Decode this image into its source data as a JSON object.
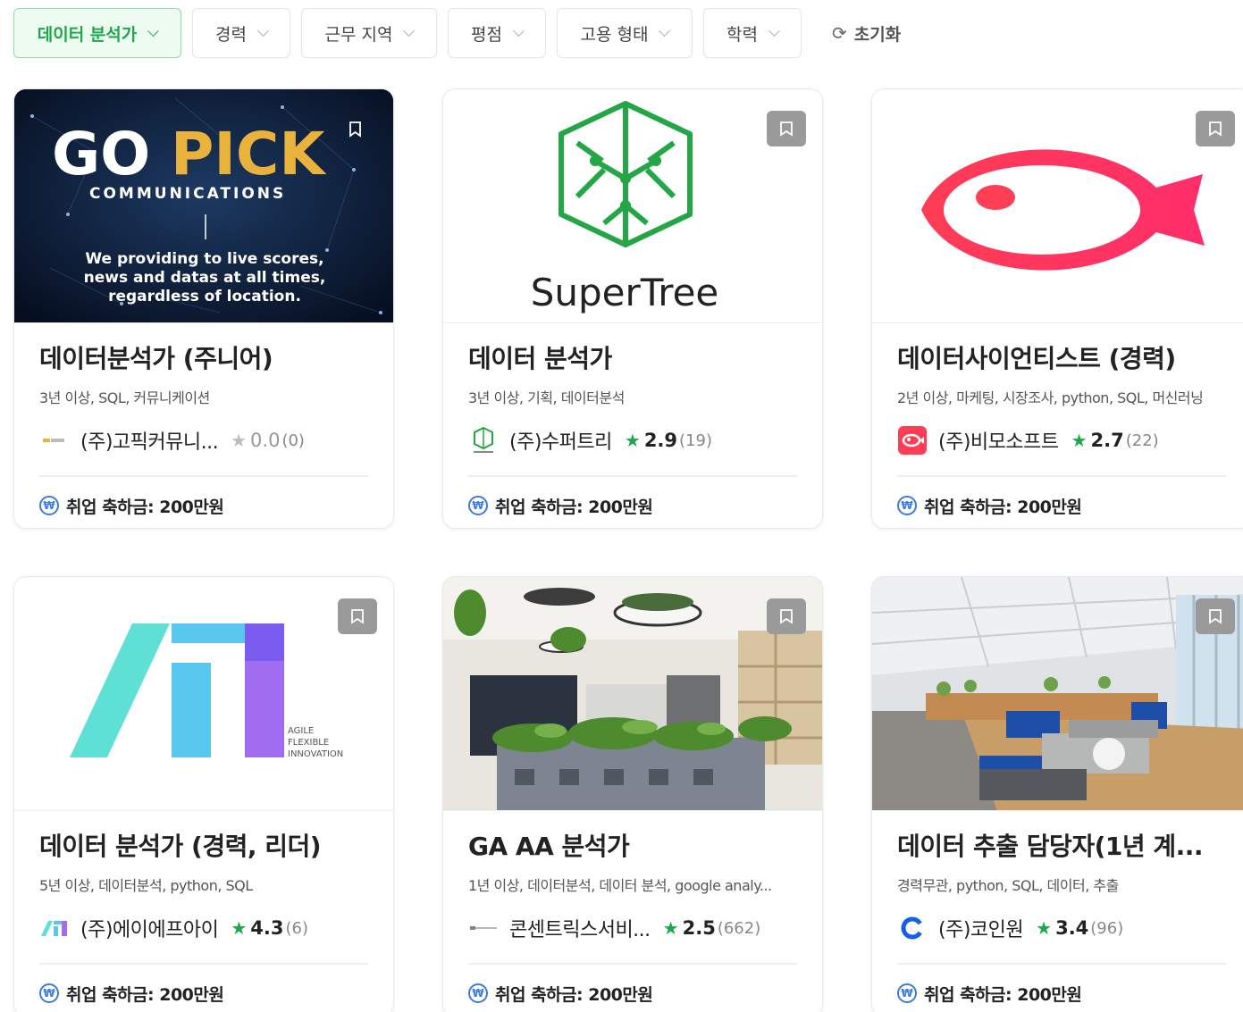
{
  "filters": [
    {
      "label": "데이터 분석가",
      "active": true
    },
    {
      "label": "경력"
    },
    {
      "label": "근무 지역"
    },
    {
      "label": "평점"
    },
    {
      "label": "고용 형태"
    },
    {
      "label": "학력"
    }
  ],
  "reset_label": "초기화",
  "cards": [
    {
      "title": "데이터분석가 (주니어)",
      "tags": "3년 이상, SQL, 커뮤니케이션",
      "company": "(주)고픽커뮤니...",
      "rating": "0.0",
      "count": "(0)",
      "bonus": "취업 축하금: 200만원",
      "logo_text": {
        "go": "GO",
        "pick": "PICK",
        "sub": "COMMUNICATIONS",
        "line1": "We providing to live scores,",
        "line2": "news and datas at all times,",
        "line3": "regardless of location."
      }
    },
    {
      "title": "데이터 분석가",
      "tags": "3년 이상, 기획, 데이터분석",
      "company": "(주)수퍼트리",
      "rating": "2.9",
      "count": "(19)",
      "bonus": "취업 축하금: 200만원",
      "logo_text": {
        "name": "SuperTree"
      }
    },
    {
      "title": "데이터사이언티스트 (경력)",
      "tags": "2년 이상, 마케팅, 시장조사, python, SQL, 머신러닝",
      "company": "(주)비모소프트",
      "rating": "2.7",
      "count": "(22)",
      "bonus": "취업 축하금: 200만원"
    },
    {
      "title": "데이터 분석가 (경력, 리더)",
      "tags": "5년 이상, 데이터분석, python, SQL",
      "company": "(주)에이에프아이",
      "rating": "4.3",
      "count": "(6)",
      "bonus": "취업 축하금: 200만원",
      "logo_text": {
        "l1": "AGILE",
        "l2": "FLEXIBLE",
        "l3": "INNOVATION"
      }
    },
    {
      "title": "GA AA 분석가",
      "tags": "1년 이상, 데이터분석, 데이터 분석, google analy...",
      "company": "콘센트릭스서비...",
      "rating": "2.5",
      "count": "(662)",
      "bonus": "취업 축하금: 200만원"
    },
    {
      "title": "데이터 추출 담당자(1년 계...",
      "tags": "경력무관, python, SQL, 데이터, 추출",
      "company": "(주)코인원",
      "rating": "3.4",
      "count": "(96)",
      "bonus": "취업 축하금: 200만원"
    }
  ],
  "colors": {
    "accent": "#1ba94c",
    "won": "#3d7be0",
    "vimo": "#ff3d55"
  }
}
